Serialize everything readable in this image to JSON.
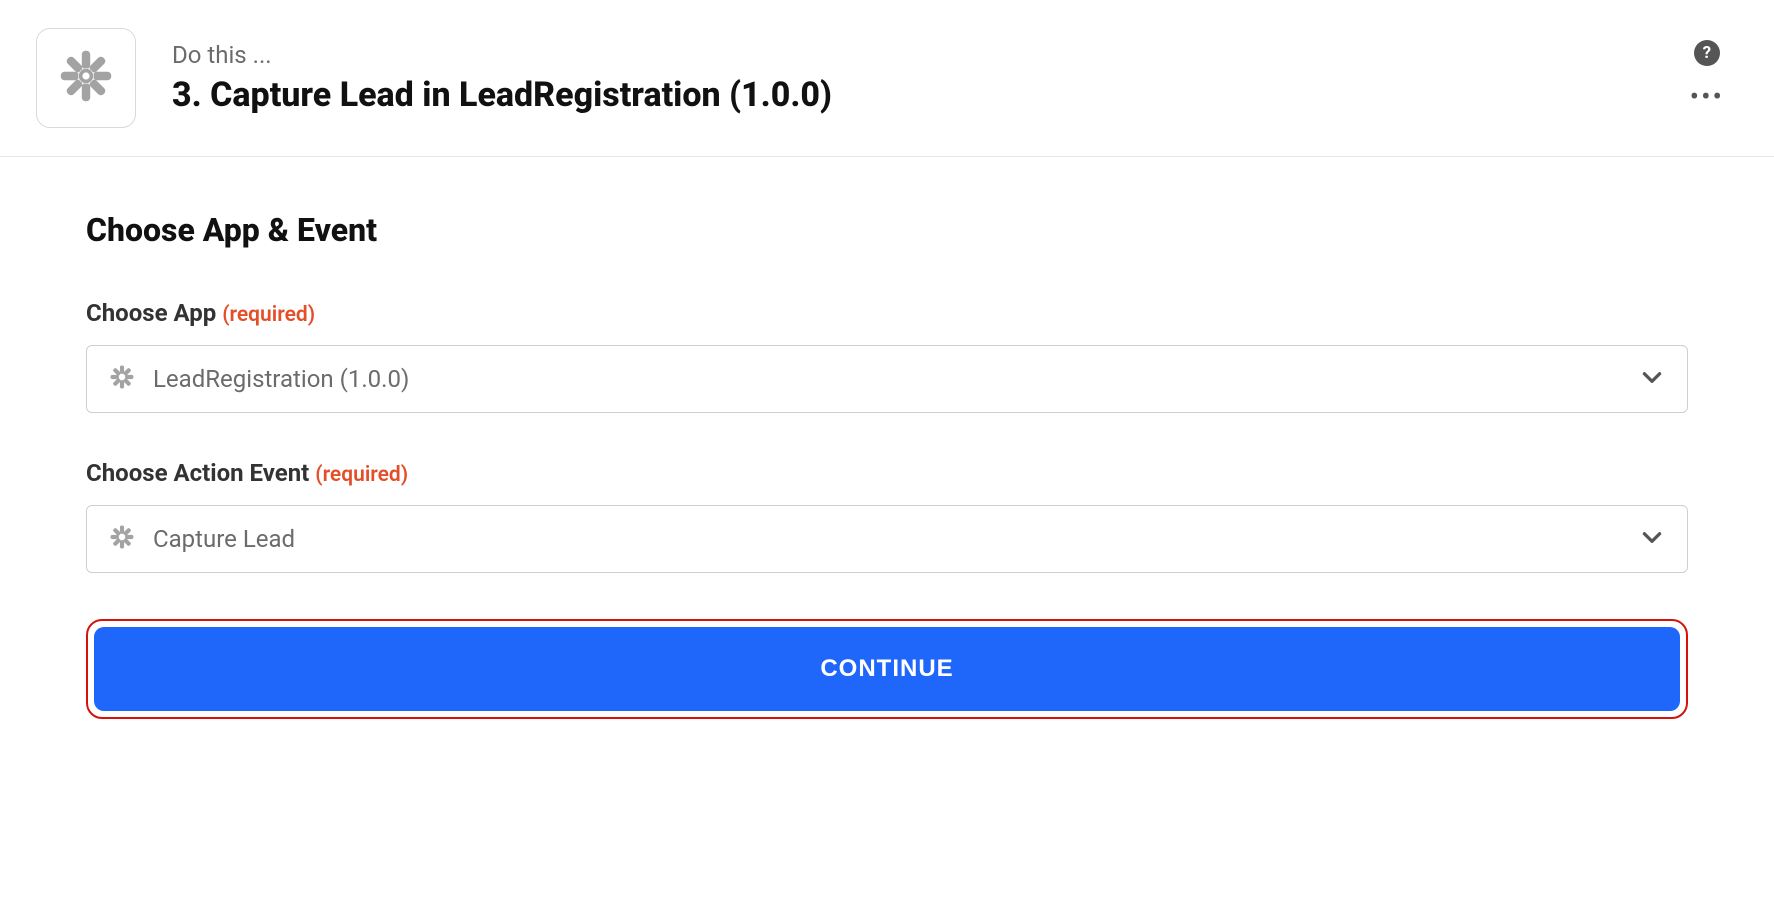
{
  "header": {
    "eyebrow": "Do this ...",
    "title": "3. Capture Lead in LeadRegistration (1.0.0)",
    "help_tooltip": "?",
    "more_label": "•••"
  },
  "section": {
    "title": "Choose App & Event"
  },
  "fields": {
    "choose_app": {
      "label": "Choose App",
      "required_text": "(required)",
      "value": "LeadRegistration (1.0.0)"
    },
    "choose_action": {
      "label": "Choose Action Event",
      "required_text": "(required)",
      "value": "Capture Lead"
    }
  },
  "buttons": {
    "continue": "CONTINUE"
  },
  "icons": {
    "app": "zapier-asterisk",
    "chevron": "chevron-down"
  },
  "colors": {
    "primary_button": "#1f66fb",
    "highlight_border": "#d5130b",
    "required_text": "#e44f29"
  }
}
